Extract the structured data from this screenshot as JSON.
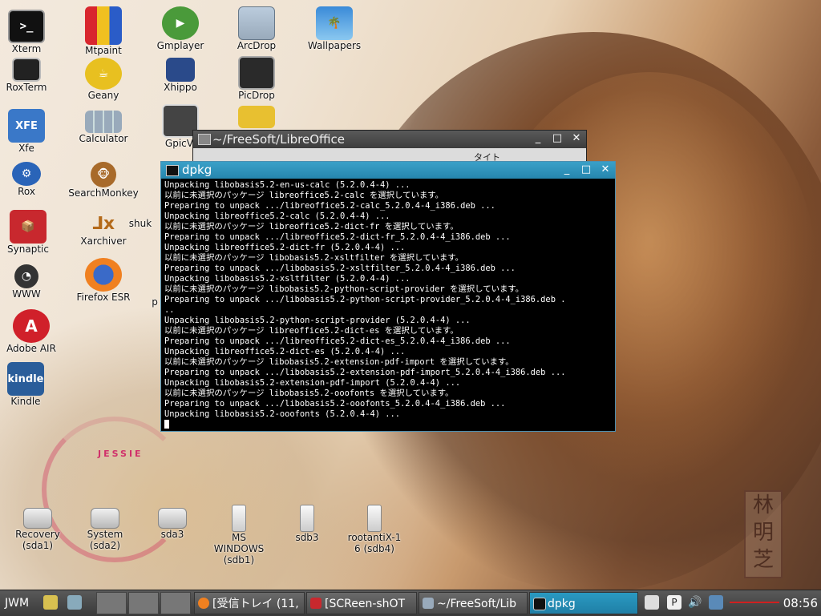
{
  "desktop": {
    "brand_text": "JESSIE",
    "seal_text": "林明芝",
    "icons": [
      {
        "label": "Xterm"
      },
      {
        "label": "RoxTerm"
      },
      {
        "label": "Xfe"
      },
      {
        "label": "Rox"
      },
      {
        "label": "Synaptic"
      },
      {
        "label": "WWW"
      },
      {
        "label": "Adobe AIR"
      },
      {
        "label": "Kindle"
      },
      {
        "label": "Mtpaint"
      },
      {
        "label": "Geany"
      },
      {
        "label": "Calculator"
      },
      {
        "label": "SearchMonkey"
      },
      {
        "label": "Xarchiver"
      },
      {
        "label": "Firefox ESR"
      },
      {
        "label": "Gmplayer"
      },
      {
        "label": "Xhippo"
      },
      {
        "label": "GpicVi"
      },
      {
        "label": "ArcDrop"
      },
      {
        "label": "PicDrop"
      },
      {
        "label": "Wallpapers"
      },
      {
        "label": "shuk"
      },
      {
        "label": "p"
      }
    ],
    "drives": [
      {
        "label": "Recovery\n(sda1)"
      },
      {
        "label": "System\n(sda2)"
      },
      {
        "label": "sda3"
      },
      {
        "label": "MS\nWINDOWS\n(sdb1)"
      },
      {
        "label": "sdb3"
      },
      {
        "label": "rootantiX-1\n6 (sdb4)"
      }
    ]
  },
  "windows": {
    "libreoffice": {
      "title": "~/FreeSoft/LibreOffice",
      "toolbar_text": "タイト"
    },
    "terminal": {
      "title": "dpkg",
      "lines": [
        "Unpacking libobasis5.2-en-us-calc (5.2.0.4-4) ...",
        "以前に未選択のパッケージ libreoffice5.2-calc を選択しています。",
        "Preparing to unpack .../libreoffice5.2-calc_5.2.0.4-4_i386.deb ...",
        "Unpacking libreoffice5.2-calc (5.2.0.4-4) ...",
        "以前に未選択のパッケージ libreoffice5.2-dict-fr を選択しています。",
        "Preparing to unpack .../libreoffice5.2-dict-fr_5.2.0.4-4_i386.deb ...",
        "Unpacking libreoffice5.2-dict-fr (5.2.0.4-4) ...",
        "以前に未選択のパッケージ libobasis5.2-xsltfilter を選択しています。",
        "Preparing to unpack .../libobasis5.2-xsltfilter_5.2.0.4-4_i386.deb ...",
        "Unpacking libobasis5.2-xsltfilter (5.2.0.4-4) ...",
        "以前に未選択のパッケージ libobasis5.2-python-script-provider を選択しています。",
        "Preparing to unpack .../libobasis5.2-python-script-provider_5.2.0.4-4_i386.deb .",
        "..",
        "Unpacking libobasis5.2-python-script-provider (5.2.0.4-4) ...",
        "以前に未選択のパッケージ libreoffice5.2-dict-es を選択しています。",
        "Preparing to unpack .../libreoffice5.2-dict-es_5.2.0.4-4_i386.deb ...",
        "Unpacking libreoffice5.2-dict-es (5.2.0.4-4) ...",
        "以前に未選択のパッケージ libobasis5.2-extension-pdf-import を選択しています。",
        "Preparing to unpack .../libobasis5.2-extension-pdf-import_5.2.0.4-4_i386.deb ...",
        "Unpacking libobasis5.2-extension-pdf-import (5.2.0.4-4) ...",
        "以前に未選択のパッケージ libobasis5.2-ooofonts を選択しています。",
        "Preparing to unpack .../libobasis5.2-ooofonts_5.2.0.4-4_i386.deb ...",
        "Unpacking libobasis5.2-ooofonts (5.2.0.4-4) ..."
      ]
    }
  },
  "window_buttons": {
    "minimize": "_",
    "maximize": "□",
    "close": "✕"
  },
  "taskbar": {
    "menu_label": "JWM",
    "tasks": [
      {
        "label": "[受信トレイ (11,",
        "icon": "firefox-icon"
      },
      {
        "label": "[SCReen-shOT",
        "icon": "screenshot-icon"
      },
      {
        "label": "~/FreeSoft/Lib",
        "icon": "folder-icon"
      },
      {
        "label": "dpkg",
        "icon": "terminal-icon"
      }
    ],
    "clock": "08:56"
  },
  "colors": {
    "accent": "#2686ae",
    "taskbar": "#4a4a4a",
    "terminal_bg": "#000000"
  }
}
